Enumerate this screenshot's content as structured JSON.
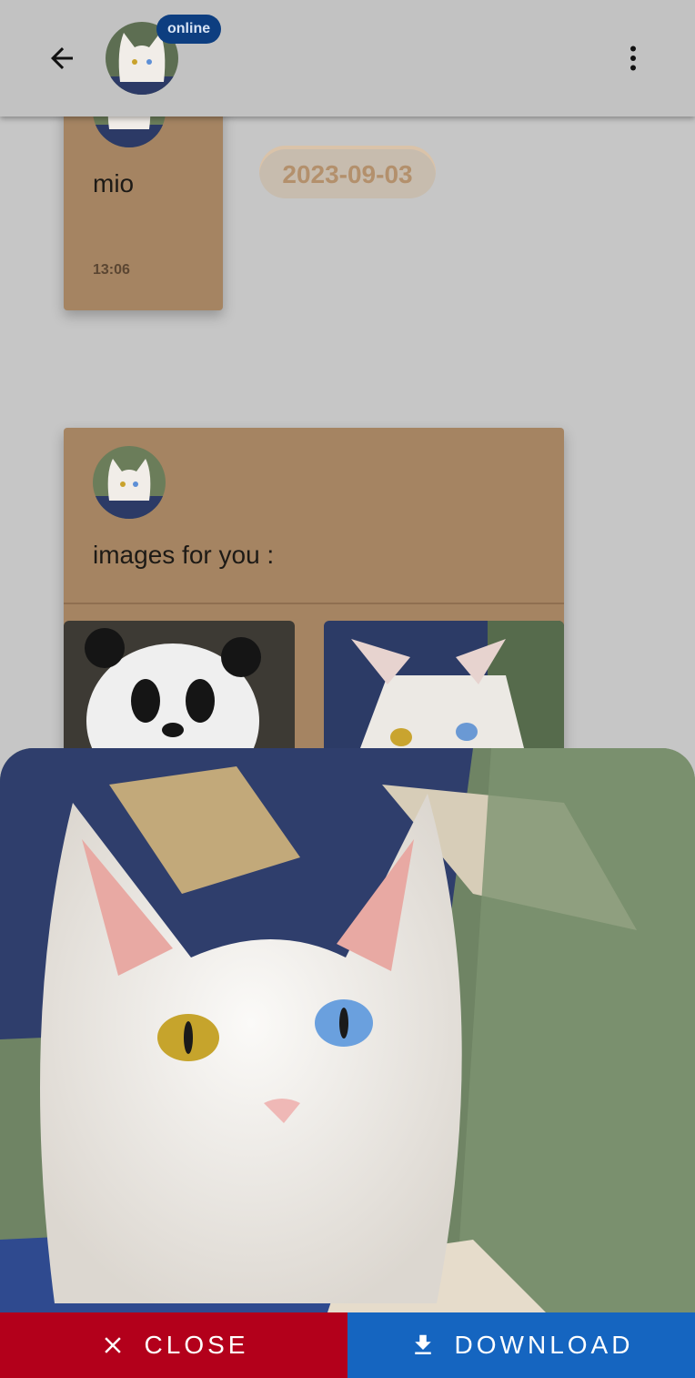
{
  "header": {
    "back_icon": "arrow-back-icon",
    "status_badge": "online",
    "menu_icon": "more-vert-icon"
  },
  "chat": {
    "message1": {
      "text": "mio",
      "time": "13:06"
    },
    "date_chip": "2023-09-03",
    "message2": {
      "text": "images for you :"
    }
  },
  "viewer": {
    "close_label": "CLOSE",
    "download_label": "DOWNLOAD",
    "close_icon": "close-icon",
    "download_icon": "download-icon"
  },
  "colors": {
    "card": "#a58462",
    "close_button": "#b3001b",
    "download_button": "#1565c0",
    "badge": "#0d3e80"
  }
}
